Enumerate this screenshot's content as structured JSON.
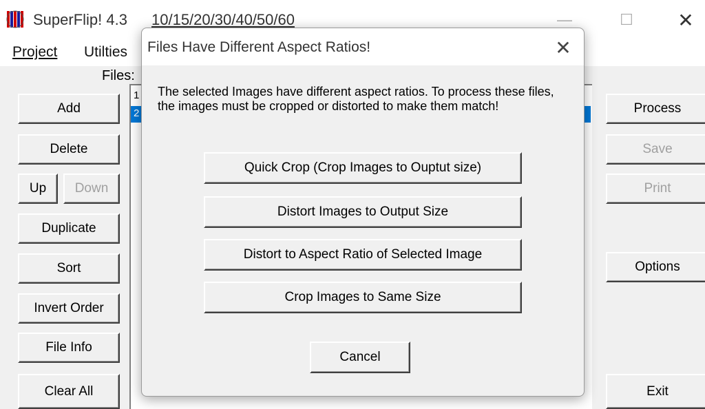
{
  "window": {
    "app_title": "SuperFlip! 4.3",
    "subtitle": "10/15/20/30/40/50/60",
    "controls": {
      "minimize": "—",
      "maximize": "☐",
      "close": "✕"
    }
  },
  "menu": {
    "project": "Project",
    "utilities": "Utilties"
  },
  "files": {
    "label": "Files:",
    "rows": [
      "1",
      "2"
    ],
    "selected_row": 2
  },
  "left_buttons": {
    "add": "Add",
    "delete": "Delete",
    "up": "Up",
    "down": "Down",
    "duplicate": "Duplicate",
    "sort": "Sort",
    "invert_order": "Invert Order",
    "file_info": "File Info",
    "clear_all": "Clear All"
  },
  "right_buttons": {
    "process": "Process",
    "save": "Save",
    "print": "Print",
    "options": "Options",
    "exit": "Exit"
  },
  "dialog": {
    "title": "Files Have Different Aspect Ratios!",
    "close": "✕",
    "message": "The selected Images have different aspect ratios.  To process these files, the images must be cropped or distorted to make them match!",
    "buttons": {
      "quick_crop": "Quick Crop (Crop Images to Ouptut size)",
      "distort_output": "Distort Images to Output Size",
      "distort_aspect": "Distort to Aspect Ratio of Selected Image",
      "crop_same": "Crop Images to Same Size",
      "cancel": "Cancel"
    }
  },
  "colors": {
    "selection": "#0078d7",
    "background": "#f0f0f0",
    "disabled_text": "#a0a0a0"
  }
}
